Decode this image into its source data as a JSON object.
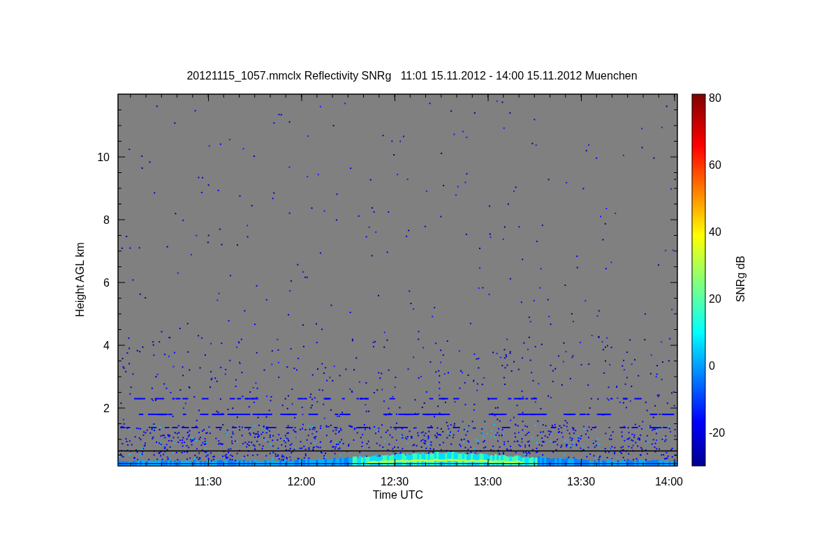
{
  "plot": {
    "title": "20121115_1057.mmclx Reflectivity SNRg   11:01 15.11.2012 - 14:00 15.11.2012 Muenchen",
    "y_axis": {
      "label": "Height AGL km",
      "ticks": [
        "10",
        "8",
        "6",
        "4",
        "2"
      ]
    },
    "x_axis": {
      "label": "Time UTC",
      "ticks": [
        "11:30",
        "12:00",
        "12:30",
        "13:00",
        "13:30",
        "14:00"
      ]
    },
    "colorbar": {
      "label": "SNRg dB",
      "ticks": [
        "80",
        "60",
        "40",
        "20",
        "0",
        "-20"
      ]
    }
  }
}
